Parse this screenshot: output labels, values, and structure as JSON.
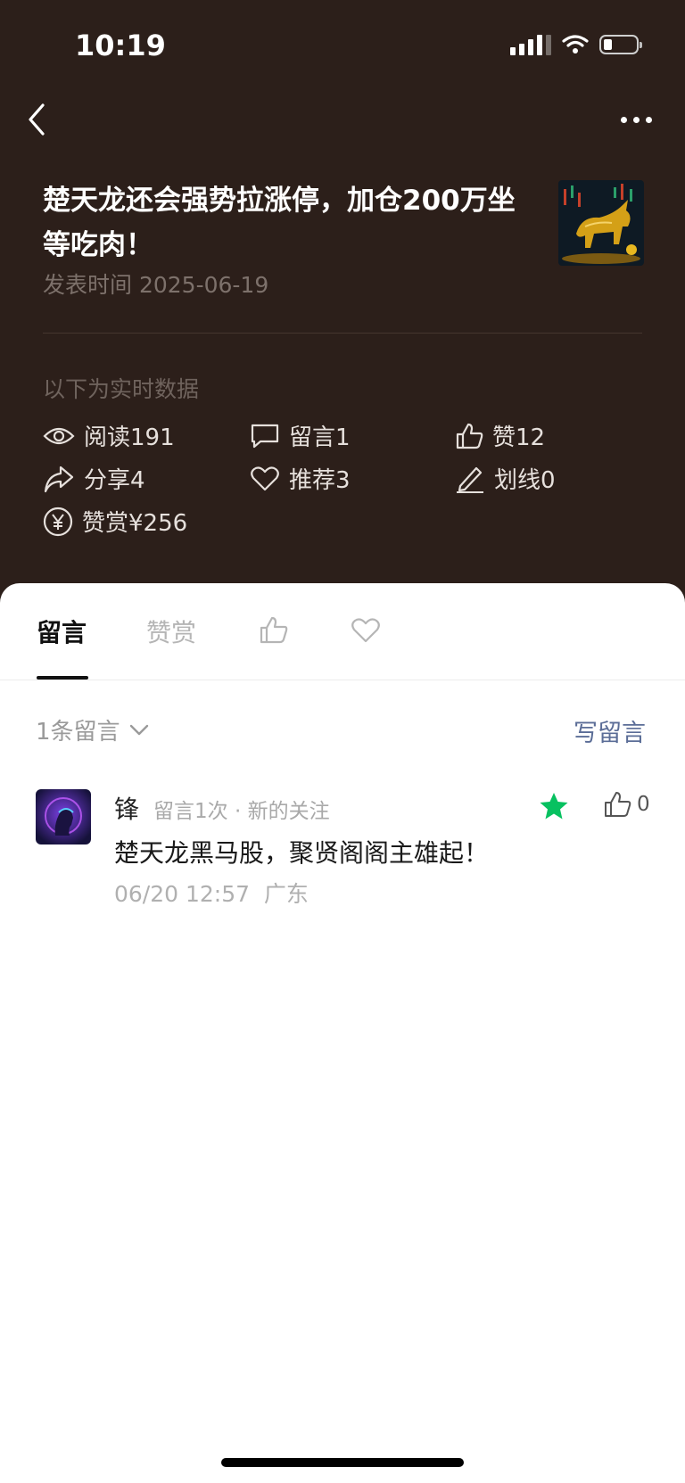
{
  "status": {
    "time": "10:19"
  },
  "article": {
    "title": "楚天龙还会强势拉涨停，加仓200万坐等吃肉！",
    "date": "发表时间 2025-06-19",
    "realtime_label": "以下为实时数据"
  },
  "stats": {
    "read": "阅读191",
    "comments": "留言1",
    "likes": "赞12",
    "share": "分享4",
    "recommend": "推荐3",
    "underline": "划线0",
    "reward": "赞赏¥256"
  },
  "tabs": {
    "comments": "留言",
    "rewards": "赞赏"
  },
  "comments_section": {
    "count_label": "1条留言",
    "write_label": "写留言",
    "items": [
      {
        "user": "锋",
        "meta": "留言1次 · 新的关注",
        "text": "楚天龙黑马股，聚贤阁阁主雄起！",
        "time_location": "06/20 12:57  广东",
        "likes": "0"
      }
    ]
  },
  "icons": [
    "back-icon",
    "more-icon",
    "eye-icon",
    "comment-icon",
    "thumb-up-icon",
    "share-icon",
    "heart-icon",
    "pen-icon",
    "yuan-icon",
    "chevron-down-icon",
    "star-icon"
  ],
  "colors": {
    "header_bg": "#2c1f1a",
    "link": "#5b6d97",
    "star": "#07c160"
  }
}
